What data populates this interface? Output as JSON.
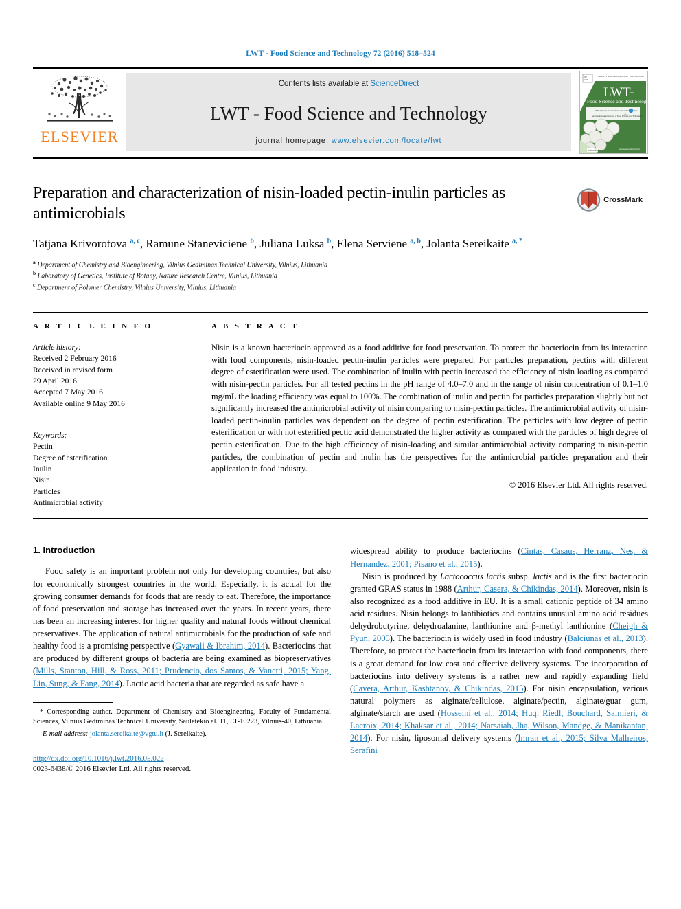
{
  "running_head": "LWT - Food Science and Technology 72 (2016) 518–524",
  "masthead": {
    "publisher": "ELSEVIER",
    "contents_prefix": "Contents lists available at ",
    "contents_link": "ScienceDirect",
    "journal_title": "LWT - Food Science and Technology",
    "homepage_prefix": "journal homepage: ",
    "homepage_url": "www.elsevier.com/locate/lwt",
    "cover": {
      "title_main": "LWT-",
      "title_sub": "Food Science and Technology",
      "top_left_label": "ISSN",
      "top_right_label": "Vol. 72"
    }
  },
  "article": {
    "title": "Preparation and characterization of nisin-loaded pectin-inulin particles as antimicrobials",
    "crossmark_label": "CrossMark",
    "authors": [
      {
        "name": "Tatjana Krivorotova",
        "marks": "a, c",
        "sep": ", "
      },
      {
        "name": "Ramune Staneviciene",
        "marks": "b",
        "sep": ", "
      },
      {
        "name": "Juliana Luksa",
        "marks": "b",
        "sep": ", "
      },
      {
        "name": "Elena Serviene",
        "marks": "a, b",
        "sep": ", "
      },
      {
        "name": "Jolanta Sereikaite",
        "marks": "a, *",
        "sep": ""
      }
    ],
    "affiliations": [
      {
        "mark": "a",
        "text": "Department of Chemistry and Bioengineering, Vilnius Gediminas Technical University, Vilnius, Lithuania"
      },
      {
        "mark": "b",
        "text": "Laboratory of Genetics, Institute of Botany, Nature Research Centre, Vilnius, Lithuania"
      },
      {
        "mark": "c",
        "text": "Department of Polymer Chemistry, Vilnius University, Vilnius, Lithuania"
      }
    ]
  },
  "article_info": {
    "heading": "A R T I C L E   I N F O",
    "history_label": "Article history:",
    "history": [
      "Received 2 February 2016",
      "Received in revised form",
      "29 April 2016",
      "Accepted 7 May 2016",
      "Available online 9 May 2016"
    ],
    "keywords_label": "Keywords:",
    "keywords": [
      "Pectin",
      "Degree of esterification",
      "Inulin",
      "Nisin",
      "Particles",
      "Antimicrobial activity"
    ]
  },
  "abstract": {
    "heading": "A B S T R A C T",
    "text": "Nisin is a known bacteriocin approved as a food additive for food preservation. To protect the bacteriocin from its interaction with food components, nisin-loaded pectin-inulin particles were prepared. For particles preparation, pectins with different degree of esterification were used. The combination of inulin with pectin increased the efficiency of nisin loading as compared with nisin-pectin particles. For all tested pectins in the pH range of 4.0–7.0 and in the range of nisin concentration of 0.1–1.0 mg/mL the loading efficiency was equal to 100%. The combination of inulin and pectin for particles preparation slightly but not significantly increased the antimicrobial activity of nisin comparing to nisin-pectin particles. The antimicrobial activity of nisin-loaded pectin-inulin particles was dependent on the degree of pectin esterification. The particles with low degree of pectin esterification or with not esterified pectic acid demonstrated the higher activity as compared with the particles of high degree of pectin esterification. Due to the high efficiency of nisin-loading and similar antimicrobial activity comparing to nisin-pectin particles, the combination of pectin and inulin has the perspectives for the antimicrobial particles preparation and their application in food industry.",
    "copyright": "© 2016 Elsevier Ltd. All rights reserved."
  },
  "introduction": {
    "heading": "1. Introduction",
    "left_paragraph_1_parts": [
      {
        "t": "Food safety is an important problem not only for developing countries, but also for economically strongest countries in the world. Especially, it is actual for the growing consumer demands for foods that are ready to eat. Therefore, the importance of food preservation and storage has increased over the years. In recent years, there has been an increasing interest for higher quality and natural foods without chemical preservatives. The application of natural antimicrobials for the production of safe and healthy food is a promising perspective (",
        "k": "n"
      },
      {
        "t": "Gyawali & Ibrahim, 2014",
        "k": "r"
      },
      {
        "t": "). Bacteriocins that are produced by different groups of bacteria are being examined as biopreservatives (",
        "k": "n"
      },
      {
        "t": "Mills, Stanton, Hill, & Ross, 2011; Prudencio, dos Santos, & Vanetti, 2015; Yang, Lin, Sung, & Fang, 2014",
        "k": "r"
      },
      {
        "t": "). Lactic acid bacteria that are regarded as safe have a",
        "k": "n"
      }
    ],
    "right_paragraph_0_parts": [
      {
        "t": "widespread ability to produce bacteriocins (",
        "k": "n"
      },
      {
        "t": "Cintas, Casaus, Herranz, Nes, & Hernandez, 2001; Pisano et al., 2015",
        "k": "r"
      },
      {
        "t": ").",
        "k": "n"
      }
    ],
    "right_paragraph_1_parts": [
      {
        "t": "Nisin is produced by ",
        "k": "n"
      },
      {
        "t": "Lactococcus lactis",
        "k": "i"
      },
      {
        "t": " subsp. ",
        "k": "n"
      },
      {
        "t": "lactis",
        "k": "i"
      },
      {
        "t": " and is the first bacteriocin granted GRAS status in 1988 (",
        "k": "n"
      },
      {
        "t": "Arthur, Casera, & Chikindas, 2014",
        "k": "r"
      },
      {
        "t": "). Moreover, nisin is also recognized as a food additive in EU. It is a small cationic peptide of 34 amino acid residues. Nisin belongs to lantibiotics and contains unusual amino acid residues dehydrobutyrine, dehydroalanine, lanthionine and β-methyl lanthionine (",
        "k": "n"
      },
      {
        "t": "Cheigh & Pyun, 2005",
        "k": "r"
      },
      {
        "t": "). The bacteriocin is widely used in food industry (",
        "k": "n"
      },
      {
        "t": "Balciunas et al., 2013",
        "k": "r"
      },
      {
        "t": "). Therefore, to protect the bacteriocin from its interaction with food components, there is a great demand for low cost and effective delivery systems. The incorporation of bacteriocins into delivery systems is a rather new and rapidly expanding field (",
        "k": "n"
      },
      {
        "t": "Cavera, Arthur, Kashtanov, & Chikindas, 2015",
        "k": "r"
      },
      {
        "t": "). For nisin encapsulation, various natural polymers as alginate/cellulose, alginate/pectin, alginate/guar gum, alginate/starch are used (",
        "k": "n"
      },
      {
        "t": "Hosseini et al., 2014; Huq, Riedl, Bouchard, Salmieri, & Lacroix, 2014; Khaksar et al., 2014; Narsaiah, Jha, Wilson, Mandge, & Manikantan, 2014",
        "k": "r"
      },
      {
        "t": "). For nisin, liposomal delivery systems (",
        "k": "n"
      },
      {
        "t": "Imran et al., 2015; Silva Malheiros, Serafini",
        "k": "r"
      }
    ]
  },
  "footnote": {
    "star": "*",
    "text": "Corresponding author. Department of Chemistry and Bioengineering, Faculty of Fundamental Sciences, Vilnius Gediminas Technical University, Sauletekio al. 11, LT-10223, Vilnius-40, Lithuania.",
    "email_label": "E-mail address:",
    "email": "jolanta.sereikaite@vgtu.lt",
    "email_suffix": "(J. Sereikaite)."
  },
  "imprint": {
    "doi": "http://dx.doi.org/10.1016/j.lwt.2016.05.022",
    "issn_line": "0023-6438/© 2016 Elsevier Ltd. All rights reserved."
  },
  "colors": {
    "link_blue": "#1a7bb9",
    "elsevier_orange": "#f08020",
    "band_grey": "#e7e7e7",
    "cover_green": "#3f7d3f"
  }
}
